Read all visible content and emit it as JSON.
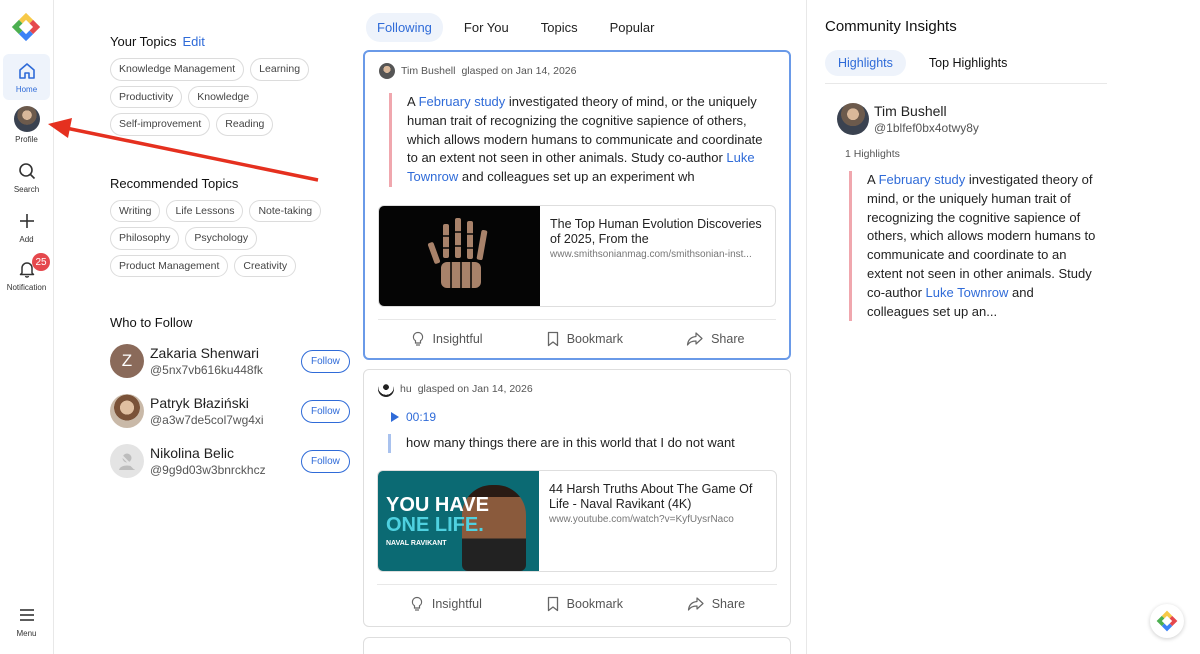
{
  "nav": {
    "home": "Home",
    "profile": "Profile",
    "search": "Search",
    "add": "Add",
    "notification": "Notification",
    "notification_count": "25",
    "menu": "Menu"
  },
  "your_topics": {
    "title": "Your Topics",
    "edit": "Edit",
    "chips": [
      "Knowledge Management",
      "Learning",
      "Productivity",
      "Knowledge",
      "Self-improvement",
      "Reading"
    ]
  },
  "recommended": {
    "title": "Recommended Topics",
    "chips": [
      "Writing",
      "Life Lessons",
      "Note-taking",
      "Philosophy",
      "Psychology",
      "Product Management",
      "Creativity"
    ]
  },
  "who_to_follow": {
    "title": "Who to Follow",
    "follow_label": "Follow",
    "users": [
      {
        "name": "Zakaria Shenwari",
        "handle": "@5nx7vb616ku448fk",
        "initial": "Z"
      },
      {
        "name": "Patryk Błaziński",
        "handle": "@a3w7de5col7wg4xi"
      },
      {
        "name": "Nikolina Belic",
        "handle": "@9g9d03w3bnrckhcz"
      }
    ]
  },
  "feed": {
    "tabs": [
      "Following",
      "For You",
      "Topics",
      "Popular"
    ],
    "posts": [
      {
        "author": "Tim Bushell",
        "meta": "glasped on Jan 14, 2026",
        "quote": {
          "t1": "A ",
          "l1": "February study",
          "t2": " investigated theory of mind, or the uniquely human trait of recognizing the cognitive sapience of others, which allows modern humans to communicate and coordinate to an extent not seen in other animals. Study co-author ",
          "l2": "Luke Townrow",
          "t3": " and colleagues set up an experiment wh"
        },
        "link_title": "The Top Human Evolution Discoveries of 2025, From the",
        "link_url": "www.smithsonianmag.com/smithsonian-inst..."
      },
      {
        "author": "hu",
        "meta": "glasped on Jan 14, 2026",
        "audio_time": "00:19",
        "quote_text": "how many things there are in this world that I do not want",
        "link_title": "44 Harsh Truths About The Game Of Life - Naval Ravikant (4K)",
        "link_url": "www.youtube.com/watch?v=KyfUysrNaco",
        "thumb_text": {
          "line1": "YOU HAVE",
          "line2": "ONE LIFE.",
          "name": "NAVAL RAVIKANT"
        }
      }
    ],
    "actions": {
      "insightful": "Insightful",
      "bookmark": "Bookmark",
      "share": "Share"
    }
  },
  "insights": {
    "title": "Community Insights",
    "tabs": [
      "Highlights",
      "Top Highlights"
    ],
    "user": {
      "name": "Tim Bushell",
      "handle": "@1blfef0bx4otwy8y"
    },
    "count": "1 Highlights",
    "quote": {
      "t1": "A ",
      "l1": "February study",
      "t2": " investigated theory of mind, or the uniquely human trait of recognizing the cognitive sapience of others, which allows modern humans to communicate and coordinate to an extent not seen in other animals. Study co-author ",
      "l2": "Luke Townrow",
      "t3": " and colleagues set up an..."
    }
  },
  "colors": {
    "accent": "#2f6bd8",
    "highlight_pink": "#f0a7ae",
    "badge": "#e5484d"
  }
}
